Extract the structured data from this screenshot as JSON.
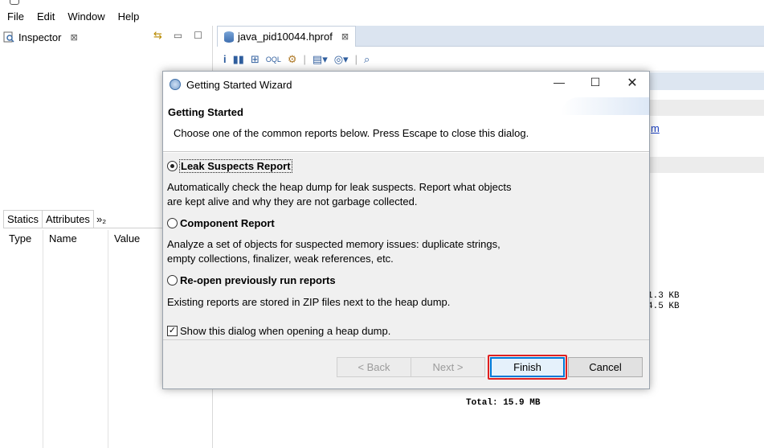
{
  "menubar": {
    "items": [
      "File",
      "Edit",
      "Window",
      "Help"
    ]
  },
  "inspector": {
    "tab_label": "Inspector",
    "close_glyph": "⊠",
    "tabs": [
      "Statics",
      "Attributes",
      "»₂"
    ],
    "columns": [
      "Type",
      "Name",
      "Value"
    ]
  },
  "editor": {
    "tab_label": "java_pid10044.hprof",
    "link_stub": "m",
    "size_1": "1.3 KB",
    "size_2": "4.5 KB",
    "total": "Total: 15.9 MB"
  },
  "dialog": {
    "title": "Getting Started Wizard",
    "heading": "Getting Started",
    "description": "Choose one of the common reports below. Press Escape to close this dialog.",
    "options": [
      {
        "label": "Leak Suspects Report",
        "selected": true,
        "desc_lines": [
          "Automatically check the heap dump for leak suspects. Report what objects",
          "are kept alive and why they are not garbage collected."
        ]
      },
      {
        "label": "Component Report",
        "selected": false,
        "desc_lines": [
          "Analyze a set of objects for suspected memory issues: duplicate strings,",
          "empty collections, finalizer, weak references, etc."
        ]
      },
      {
        "label": "Re-open previously run reports",
        "selected": false,
        "desc_lines": [
          "Existing reports are stored in ZIP files next to the heap dump."
        ]
      }
    ],
    "checkbox_label": "Show this dialog when opening a heap dump.",
    "checkbox_checked": true,
    "buttons": {
      "back": "< Back",
      "next": "Next >",
      "finish": "Finish",
      "cancel": "Cancel"
    },
    "highlight_color": "#e02020"
  }
}
